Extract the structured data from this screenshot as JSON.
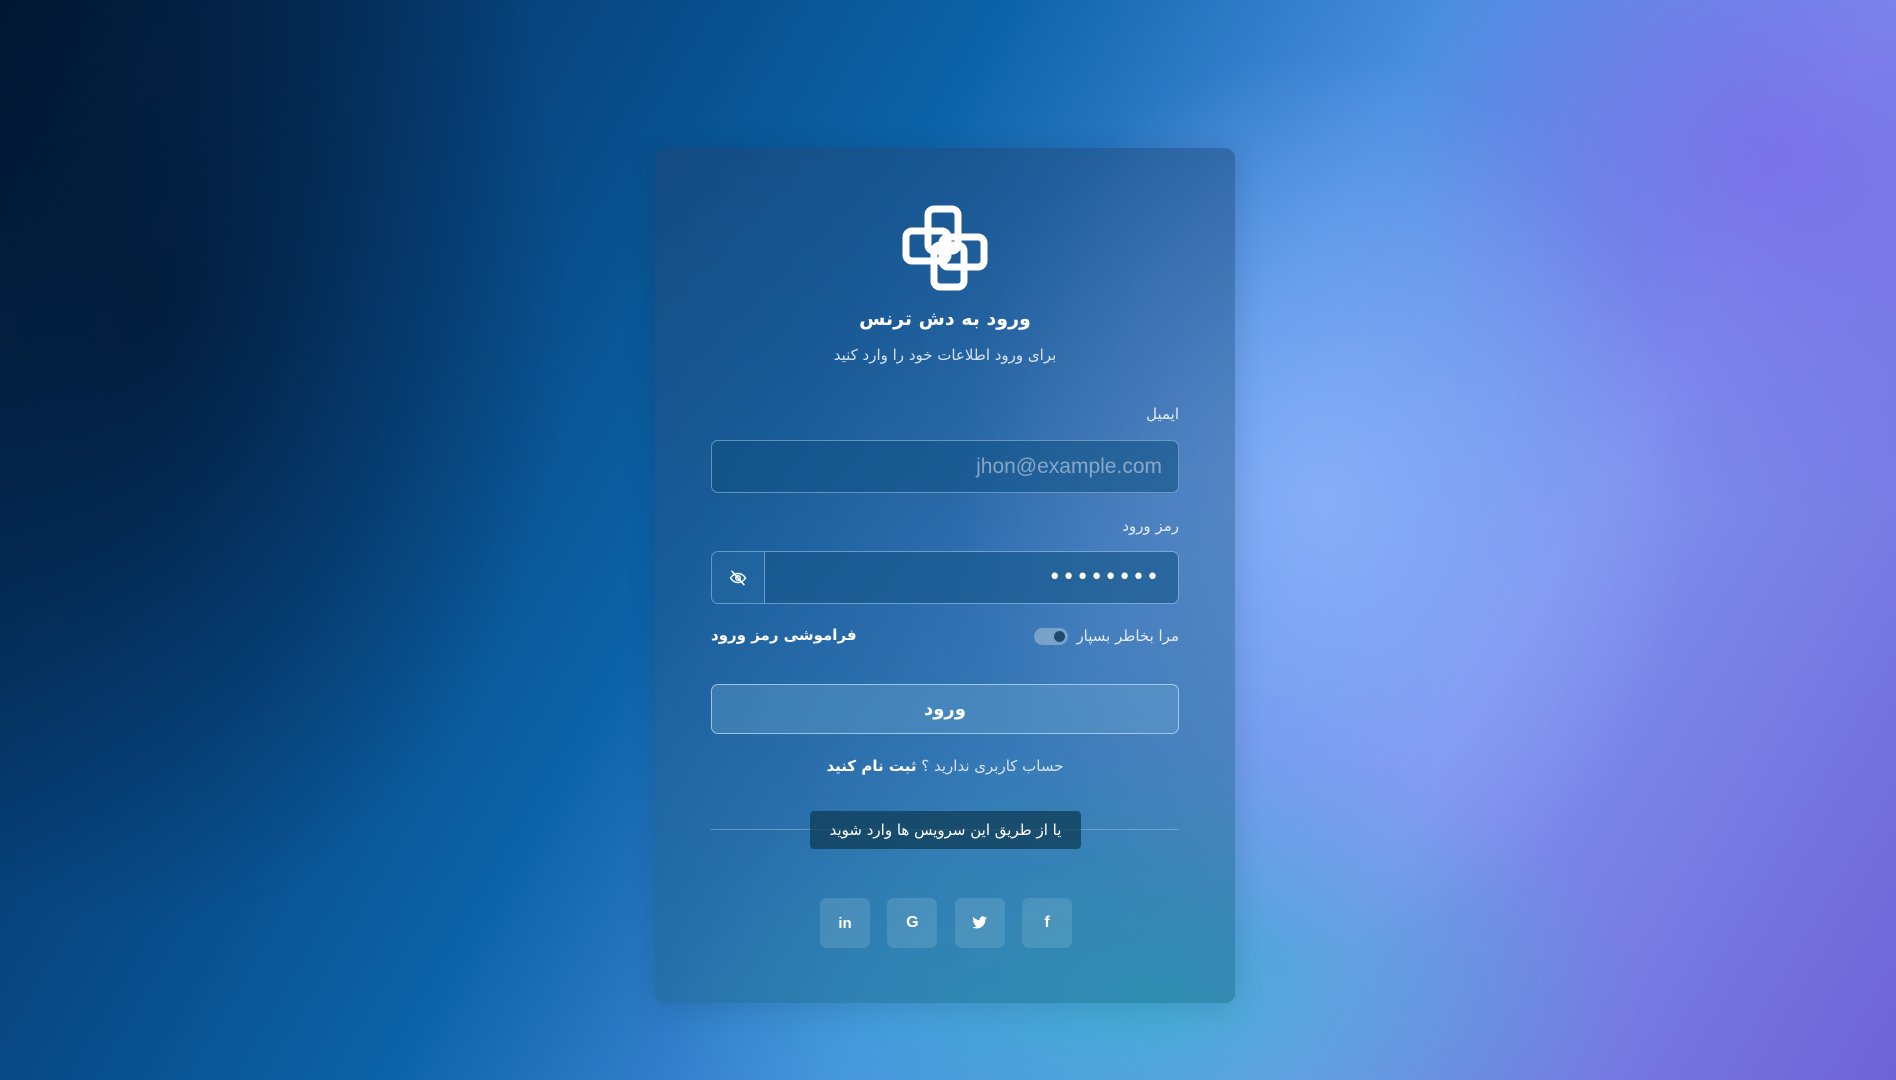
{
  "app": {
    "title": "ورود به دش ترنس",
    "subtitle": "برای ورود اطلاعات خود را وارد کنید"
  },
  "form": {
    "email_label": "ایمیل",
    "email_placeholder": "jhon@example.com",
    "password_label": "رمز ورود",
    "password_value": "••••••••",
    "remember_label": "مرا بخاطر بسپار",
    "remember_checked": true,
    "forgot_label": "فراموشی رمز ورود",
    "submit_label": "ورود"
  },
  "signup": {
    "prompt": "حساب کاربری ندارید ؟",
    "link": "ثبت نام کنید"
  },
  "divider_text": "یا از طریق این سرویس ها وارد شوید",
  "socials": [
    {
      "icon": "linkedin-icon",
      "glyph": "in"
    },
    {
      "icon": "google-icon",
      "glyph": "G"
    },
    {
      "icon": "twitter-icon",
      "glyph": ""
    },
    {
      "icon": "facebook-icon",
      "glyph": "f"
    }
  ],
  "colors": {
    "card_bg": "#2a5f8c",
    "text_primary": "#ffffff",
    "text_secondary": "#d6e2ef"
  }
}
